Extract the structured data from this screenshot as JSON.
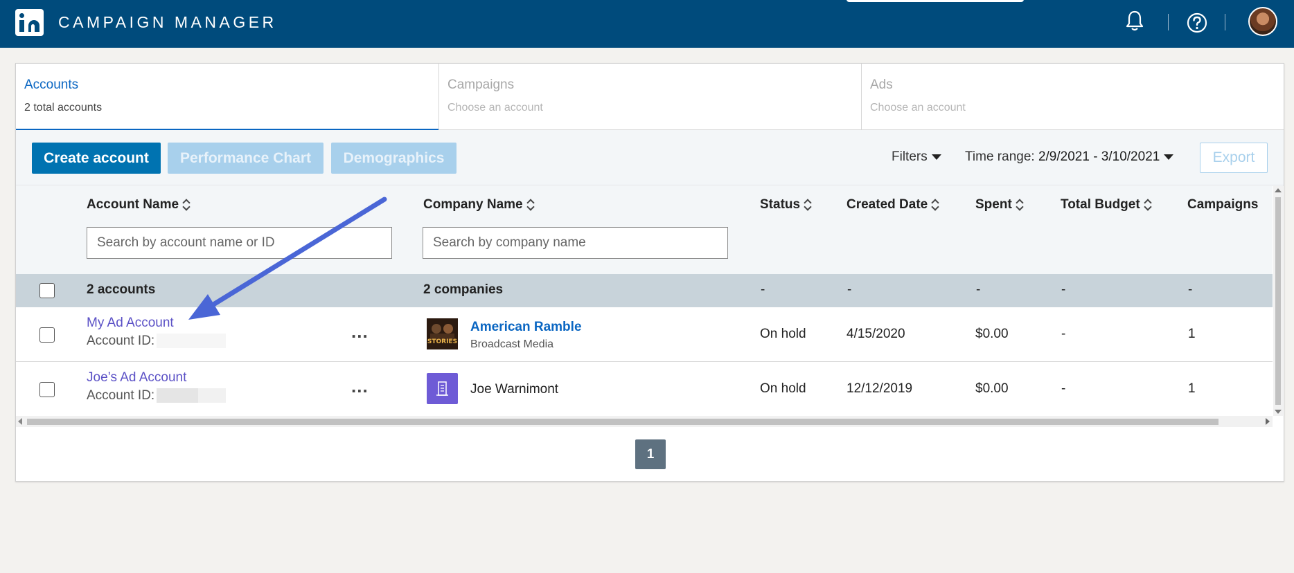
{
  "app": {
    "title": "CAMPAIGN MANAGER"
  },
  "colors": {
    "brand": "#004b7c",
    "primary": "#0073b1",
    "link_purple": "#5b51c6",
    "annotation_arrow": "#4a66d6"
  },
  "icons": {
    "logo": "linkedin-logo-icon",
    "bell": "bell-icon",
    "help": "help-icon",
    "avatar": "avatar"
  },
  "tabs": [
    {
      "title": "Accounts",
      "subtitle": "2 total accounts"
    },
    {
      "title": "Campaigns",
      "subtitle": "Choose an account"
    },
    {
      "title": "Ads",
      "subtitle": "Choose an account"
    }
  ],
  "toolbar": {
    "create_label": "Create account",
    "perf_chart_label": "Performance Chart",
    "demographics_label": "Demographics",
    "filters_label": "Filters",
    "time_range_label": "Time range:",
    "time_range_value": "2/9/2021 - 3/10/2021",
    "export_label": "Export"
  },
  "table": {
    "headers": {
      "account_name": "Account Name",
      "company_name": "Company Name",
      "status": "Status",
      "created_date": "Created Date",
      "spent": "Spent",
      "total_budget": "Total Budget",
      "campaigns": "Campaigns"
    },
    "search": {
      "account_placeholder": "Search by account name or ID",
      "company_placeholder": "Search by company name"
    },
    "summary": {
      "accounts": "2 accounts",
      "companies": "2 companies",
      "status": "-",
      "created_date": "-",
      "spent": "-",
      "total_budget": "-",
      "campaigns": "-"
    },
    "rows": [
      {
        "account_name": "My Ad Account",
        "account_id_label": "Account ID:",
        "menu": "...",
        "company_name": "American Ramble",
        "company_sub": "Broadcast Media",
        "company_logo_text": "STORIES",
        "status": "On hold",
        "created_date": "4/15/2020",
        "spent": "$0.00",
        "total_budget": "-",
        "campaigns": "1"
      },
      {
        "account_name": "Joe’s Ad Account",
        "account_id_label": "Account ID:",
        "menu": "...",
        "company_name": "Joe Warnimont",
        "status": "On hold",
        "created_date": "12/12/2019",
        "spent": "$0.00",
        "total_budget": "-",
        "campaigns": "1"
      }
    ]
  },
  "pagination": {
    "current_page": "1"
  }
}
